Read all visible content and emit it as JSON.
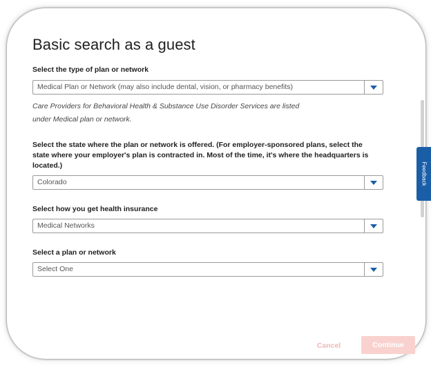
{
  "title": "Basic search as a guest",
  "plan_type": {
    "label": "Select the type of plan or network",
    "value": "Medical Plan or Network (may also include dental, vision, or pharmacy benefits)"
  },
  "note": {
    "line1": "Care Providers for Behavioral Health & Substance Use Disorder Services are listed",
    "line2": "under Medical plan or network."
  },
  "state": {
    "label": "Select the state where the plan or network is offered. (For employer-sponsored plans, select the state where your employer's plan is contracted in. Most of the time, it's where the headquarters is located.)",
    "value": "Colorado"
  },
  "insurance_source": {
    "label": "Select how you get health insurance",
    "value": "Medical Networks"
  },
  "plan": {
    "label": "Select a plan or network",
    "value": "Select One"
  },
  "feedback_tab": {
    "label": "Feedback"
  },
  "footer": {
    "cancel_label": "Cancel",
    "continue_label": "Continue"
  },
  "colors": {
    "accent": "#1a5ea8",
    "continue_disabled": "#f9d2cf",
    "cancel_disabled": "#f0b7b4"
  }
}
